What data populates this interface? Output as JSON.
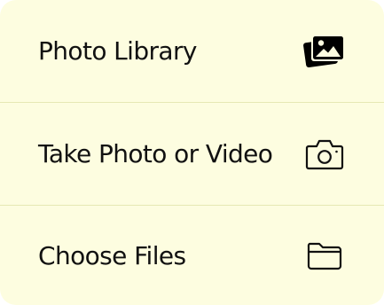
{
  "menu": {
    "items": [
      {
        "label": "Photo Library",
        "icon": "photo-library-icon"
      },
      {
        "label": "Take Photo or Video",
        "icon": "camera-icon"
      },
      {
        "label": "Choose Files",
        "icon": "folder-icon"
      }
    ]
  }
}
